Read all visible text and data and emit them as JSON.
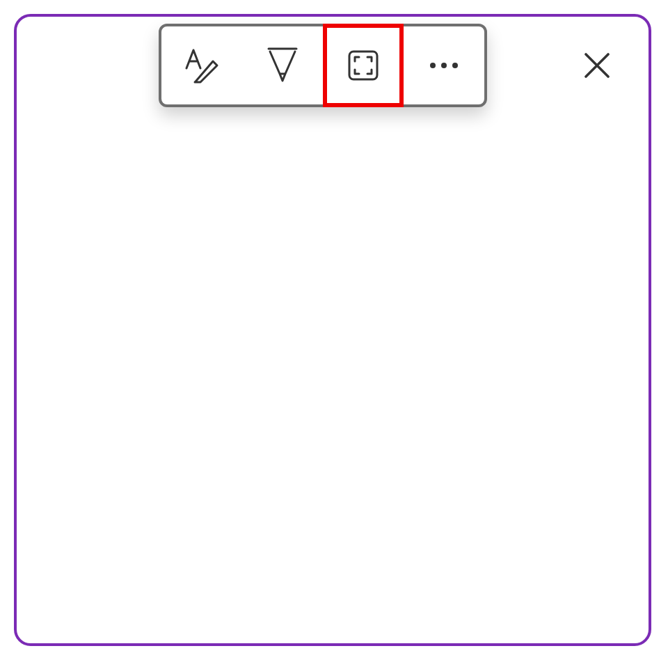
{
  "toolbar": {
    "tools": [
      {
        "kind": "text-pen",
        "selected": false
      },
      {
        "kind": "highlighter",
        "selected": false
      },
      {
        "kind": "capture",
        "selected": true
      },
      {
        "kind": "more",
        "selected": false
      }
    ]
  },
  "close_button": {
    "kind": "close"
  }
}
